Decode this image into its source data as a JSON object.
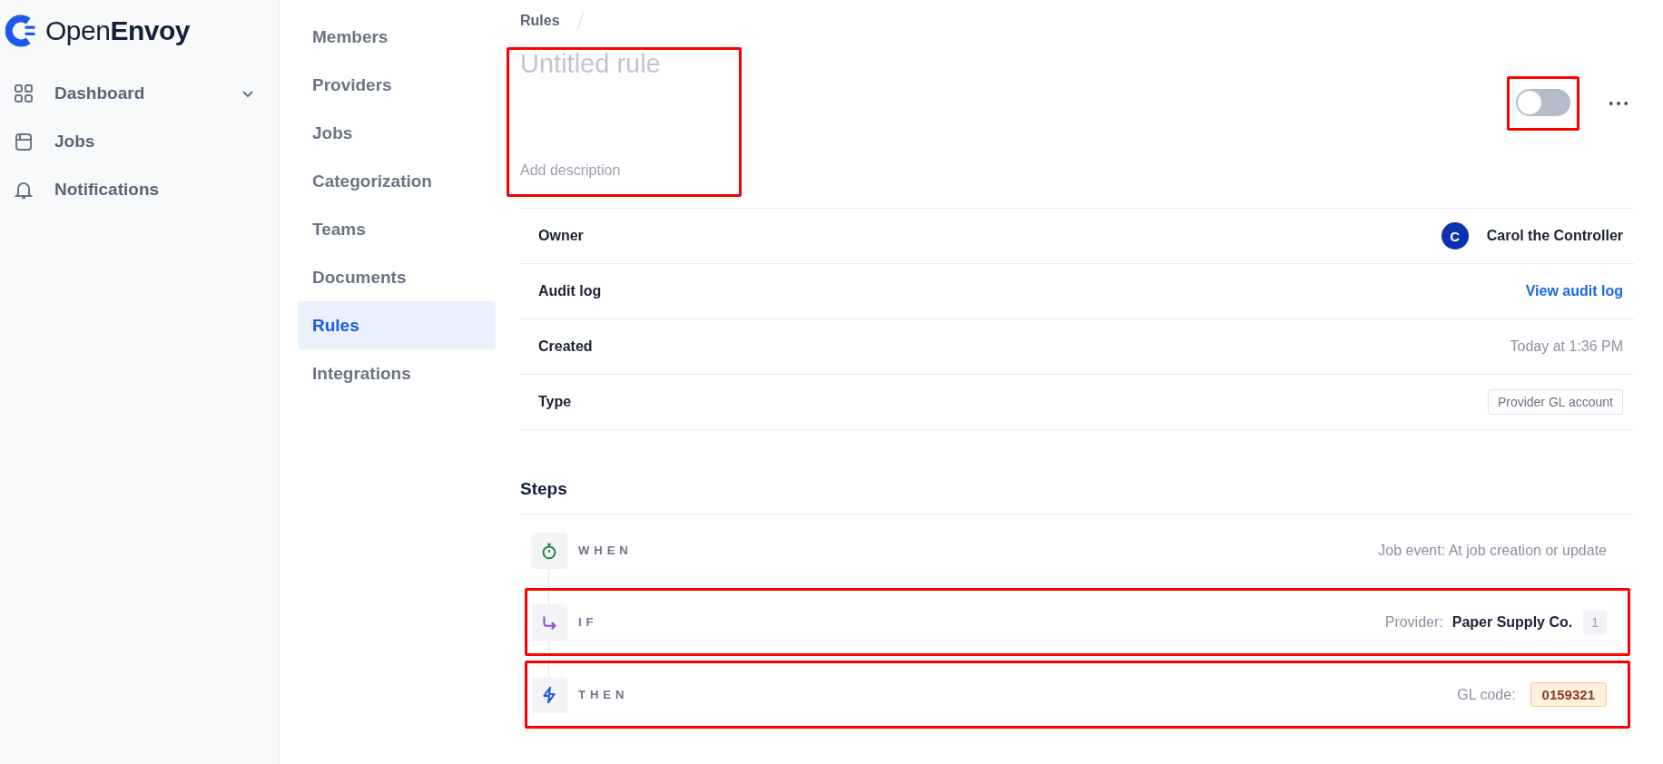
{
  "brand": {
    "name_light": "Open",
    "name_bold": "Envoy"
  },
  "sidebar": {
    "items": [
      {
        "label": "Dashboard",
        "kind": "grid",
        "expanded": false
      },
      {
        "label": "Jobs",
        "kind": "box"
      },
      {
        "label": "Notifications",
        "kind": "bell"
      }
    ]
  },
  "settings_nav": {
    "items": [
      {
        "label": "Members",
        "selected": false
      },
      {
        "label": "Providers",
        "selected": false
      },
      {
        "label": "Jobs",
        "selected": false
      },
      {
        "label": "Categorization",
        "selected": false
      },
      {
        "label": "Teams",
        "selected": false
      },
      {
        "label": "Documents",
        "selected": false
      },
      {
        "label": "Rules",
        "selected": true
      },
      {
        "label": "Integrations",
        "selected": false
      }
    ]
  },
  "breadcrumb": [
    "Rules"
  ],
  "rule": {
    "title_placeholder": "Untitled rule",
    "description_placeholder": "Add description",
    "highlighted": true,
    "toggle": {
      "on": false,
      "highlighted": true
    }
  },
  "details": [
    {
      "label": "Owner",
      "kind": "person",
      "initial": "C",
      "value": "Carol the Controller"
    },
    {
      "label": "Audit log",
      "kind": "link",
      "value": "View audit log"
    },
    {
      "label": "Created",
      "kind": "text",
      "value": "Today at 1:36 PM"
    },
    {
      "label": "Type",
      "kind": "tag",
      "value": "Provider GL account"
    }
  ],
  "steps": {
    "title": "Steps",
    "items": [
      {
        "kind": "when",
        "label": "WHEN",
        "highlighted": false,
        "text": "Job event: At job creation or update"
      },
      {
        "kind": "if",
        "label": "IF",
        "highlighted": true,
        "field": "Provider:",
        "value": "Paper Supply Co.",
        "count": "1"
      },
      {
        "kind": "then",
        "label": "THEN",
        "highlighted": true,
        "field": "GL code:",
        "code": "0159321"
      }
    ]
  }
}
